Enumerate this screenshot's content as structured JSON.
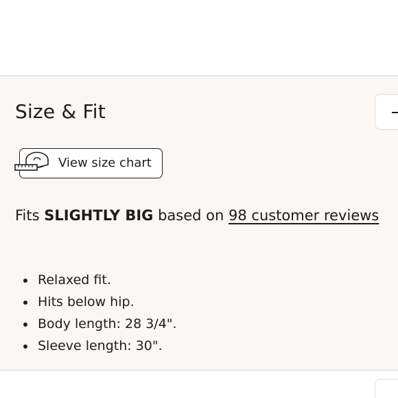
{
  "size_fit": {
    "title": "Size & Fit",
    "collapse_icon": "minus-icon",
    "size_chart_button": {
      "label": "View size chart",
      "icon": "measuring-tape-icon"
    },
    "fit_summary": {
      "prefix": "Fits",
      "fit_value": "SLIGHTLY BIG",
      "middle": "based on",
      "reviews_link": "98 customer reviews"
    },
    "details": [
      "Relaxed fit.",
      "Hits below hip.",
      "Body length: 28 3/4\".",
      "Sleeve length: 30\"."
    ]
  },
  "colors": {
    "section_background": "#fbf7f5",
    "text": "#1c1c1c",
    "divider": "#d9d3cf"
  }
}
